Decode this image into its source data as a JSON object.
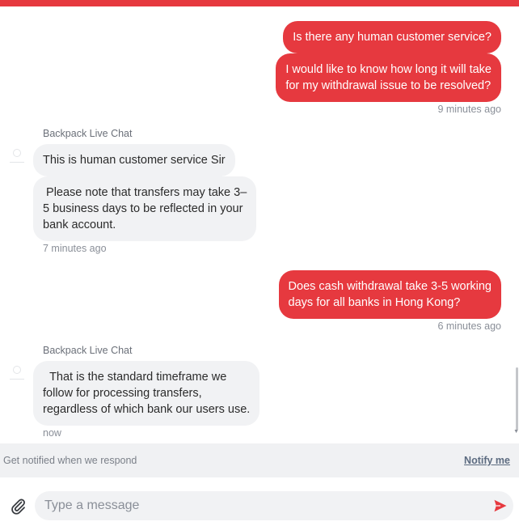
{
  "colors": {
    "accent": "#e6393f",
    "agent_bubble": "#f1f2f4",
    "muted": "#8a8f98"
  },
  "messages": [
    {
      "from": "user",
      "text": "Is there any human customer service?"
    },
    {
      "from": "user",
      "text": "I would like to know how long it will take\nfor my withdrawal issue to be resolved?"
    },
    {
      "timestamp": "9 minutes ago"
    },
    {
      "from": "agent",
      "sender": "Backpack Live Chat",
      "text": "This is human customer service Sir"
    },
    {
      "from": "agent",
      "text": " Please note that transfers may take 3–\n5 business days to be reflected in your\nbank account."
    },
    {
      "timestamp": "7 minutes ago"
    },
    {
      "from": "user",
      "text": "Does cash withdrawal take 3-5 working\ndays for all banks in Hong Kong?"
    },
    {
      "timestamp": "6 minutes ago"
    },
    {
      "from": "agent",
      "sender": "Backpack Live Chat",
      "text": "  That is the standard timeframe we\nfollow for processing transfers,\nregardless of which bank our users use."
    },
    {
      "timestamp": "now"
    }
  ],
  "notify": {
    "text": "Get notified when we respond",
    "link": "Notify me"
  },
  "composer": {
    "placeholder": "Type a message",
    "value": ""
  },
  "icons": {
    "attach": "paperclip-icon",
    "send": "send-arrow-icon",
    "avatar": "agent-avatar-icon"
  }
}
